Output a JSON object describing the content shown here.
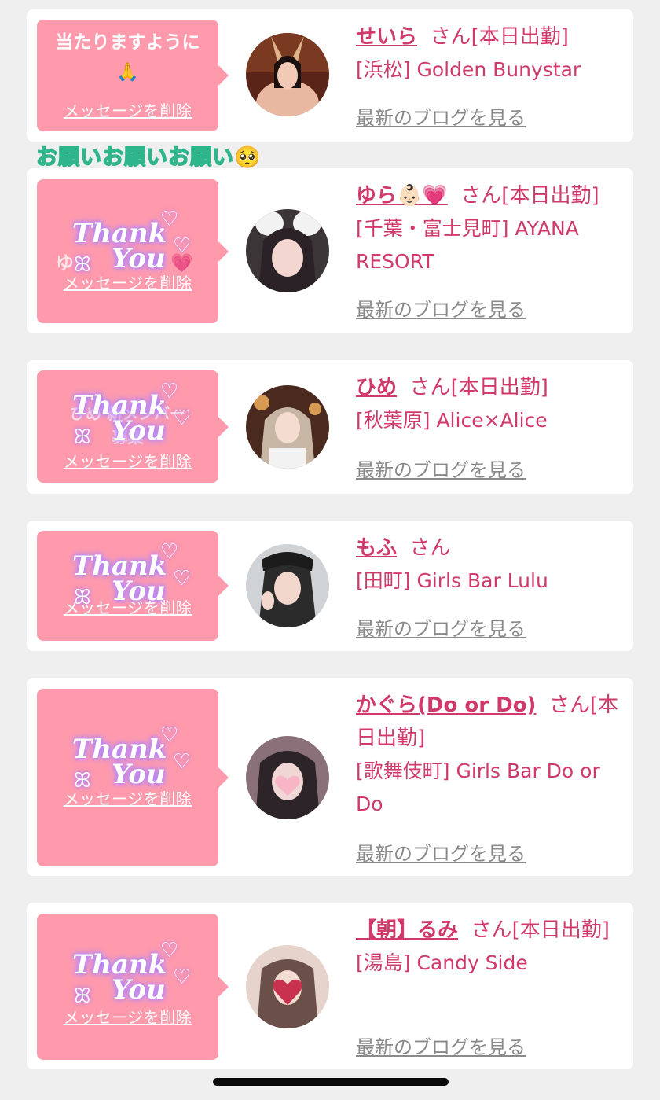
{
  "colors": {
    "page_bg": "#efefef",
    "bubble": "#ff9aac",
    "name": "#d03a6a",
    "blog_link": "#8a8a8a"
  },
  "delete_label": "メッセージを削除",
  "blog_label": "最新のブログを見る",
  "stamp": {
    "word1": "Thank",
    "word2": "You",
    "heart": "♡",
    "bow": "ꕤ"
  },
  "between_text": "お願いお願いお願い🥺",
  "cards": [
    {
      "message": "当たりますように\n🙏",
      "stamp": false,
      "name": "せいら",
      "san": "さん",
      "status": "[本日出勤]",
      "location": "[浜松] Golden Bunystar"
    },
    {
      "message": "ゆ",
      "message_tail": "💗",
      "stamp": true,
      "name": "ゆら👶🏻💗",
      "san": "さん",
      "status": "[本日出勤]",
      "location": "[千葉・富士見町] AYANA RESORT"
    },
    {
      "message": "ひめ",
      "message_tail": "新メンバー\n募集",
      "stamp": true,
      "name": "ひめ",
      "san": "さん",
      "status": "[本日出勤]",
      "location": "[秋葉原] Alice×Alice"
    },
    {
      "message": "",
      "stamp": true,
      "name": "もふ",
      "san": "さん",
      "status": "",
      "location": "[田町] Girls Bar Lulu"
    },
    {
      "message": "",
      "stamp": true,
      "name": "かぐら(Do or Do)",
      "san": "さん",
      "status": "[本日出勤]",
      "location": "[歌舞伎町] Girls Bar Do or Do"
    },
    {
      "message": "",
      "stamp": true,
      "name": "【朝】るみ",
      "san": "さん",
      "status": "[本日出勤]",
      "location": "[湯島] Candy Side"
    }
  ]
}
